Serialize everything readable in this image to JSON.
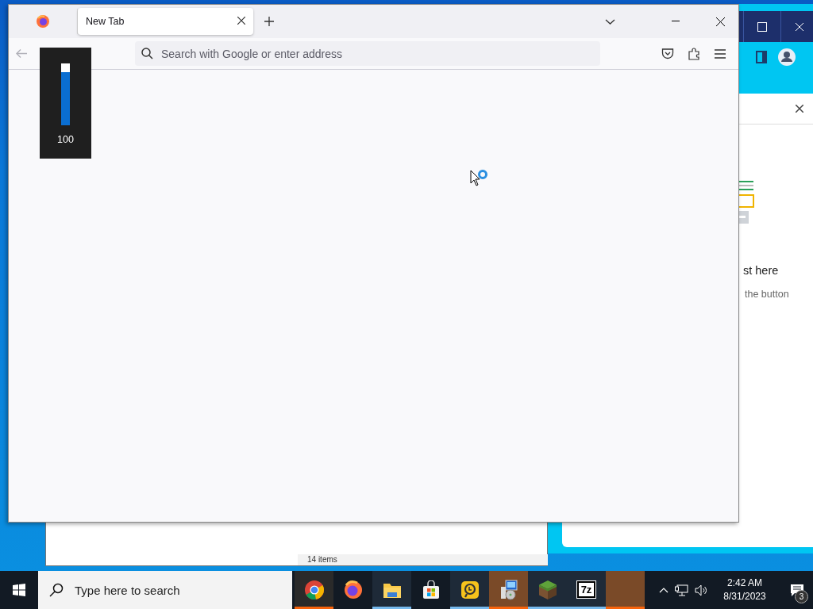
{
  "browser": {
    "tabs": [
      {
        "label": "New Tab",
        "selected": true
      }
    ],
    "address_bar": {
      "placeholder": "Search with Google or enter address"
    }
  },
  "volume_osd": {
    "level": 0.86,
    "reading": "100"
  },
  "background_app": {
    "text_1": "st here",
    "text_2": "the button"
  },
  "explorer_window": {
    "status": "14 items"
  },
  "taskbar": {
    "search": {
      "placeholder": "Type here to search"
    },
    "apps": [
      {
        "kind": "chrome",
        "running": false,
        "attention": true
      },
      {
        "kind": "firefox",
        "running": false,
        "attention": false
      },
      {
        "kind": "folder",
        "running": true,
        "attention": false
      },
      {
        "kind": "store",
        "running": false,
        "attention": false
      },
      {
        "kind": "recovery",
        "running": true,
        "attention": false
      },
      {
        "kind": "installer",
        "running": false,
        "attention": true
      },
      {
        "kind": "cube",
        "running": true,
        "attention": false
      },
      {
        "kind": "archiver",
        "label": "7z",
        "running": true,
        "attention": false
      },
      {
        "kind": "blank",
        "running": false,
        "attention": true
      }
    ],
    "clock": {
      "time": "2:42 AM",
      "date": "8/31/2023"
    },
    "notifications": {
      "count": "3"
    }
  }
}
